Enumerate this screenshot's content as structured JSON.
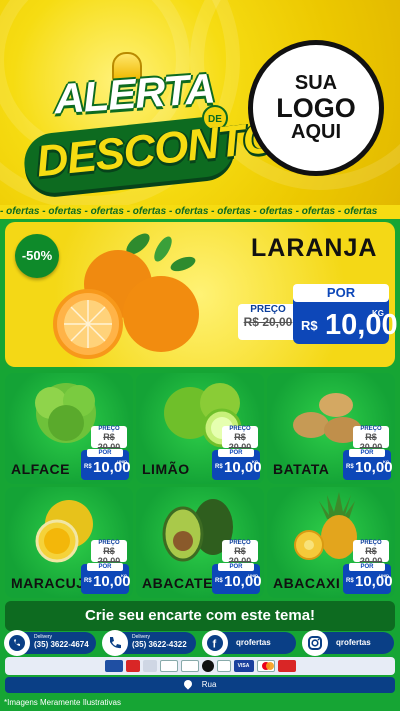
{
  "header": {
    "title_line1": "ALERTA",
    "title_de": "DE",
    "title_line2": "DESCONTO",
    "logo_placeholder": [
      "SUA",
      "LOGO",
      "AQUI"
    ]
  },
  "strip_word": "ofertas",
  "featured": {
    "discount": "-50%",
    "name": "LARANJA",
    "old_label": "PREÇO",
    "old_price": "R$ 20,00",
    "new_label": "POR",
    "currency": "R$",
    "price": "10,00",
    "unit": "KG"
  },
  "products": [
    {
      "name": "ALFACE",
      "old_label": "PREÇO",
      "old_price": "R$ 20,00",
      "new_label": "POR",
      "currency": "R$",
      "price": "10,00",
      "unit": "UNID",
      "icon": "lettuce-icon"
    },
    {
      "name": "LIMÃO",
      "old_label": "PREÇO",
      "old_price": "R$ 20,00",
      "new_label": "POR",
      "currency": "R$",
      "price": "10,00",
      "unit": "KG",
      "icon": "lime-icon"
    },
    {
      "name": "BATATA",
      "old_label": "PREÇO",
      "old_price": "R$ 20,00",
      "new_label": "POR",
      "currency": "R$",
      "price": "10,00",
      "unit": "KG",
      "icon": "potato-icon"
    },
    {
      "name": "MARACUJÁ",
      "old_label": "PREÇO",
      "old_price": "R$ 20,00",
      "new_label": "POR",
      "currency": "R$",
      "price": "10,00",
      "unit": "KG",
      "icon": "passionfruit-icon"
    },
    {
      "name": "ABACATE",
      "old_label": "PREÇO",
      "old_price": "R$ 20,00",
      "new_label": "POR",
      "currency": "R$",
      "price": "10,00",
      "unit": "UNID",
      "icon": "avocado-icon"
    },
    {
      "name": "ABACAXI",
      "old_label": "PREÇO",
      "old_price": "R$ 20,00",
      "new_label": "POR",
      "currency": "R$",
      "price": "10,00",
      "unit": "UNID",
      "icon": "pineapple-icon"
    }
  ],
  "cta": "Crie seu encarte com este tema!",
  "contacts": [
    {
      "icon": "whatsapp-icon",
      "small": "Delivery",
      "text": "(35) 3622-4674"
    },
    {
      "icon": "phone-icon",
      "small": "Delivery",
      "text": "(35) 3622-4322"
    },
    {
      "icon": "facebook-icon",
      "small": "",
      "text": "qrofertas"
    },
    {
      "icon": "instagram-icon",
      "small": "",
      "text": "qrofertas"
    }
  ],
  "payments": [
    "",
    "",
    "",
    "",
    "",
    "",
    "VISA",
    "",
    ""
  ],
  "address": "Rua",
  "footnote": "*Imagens Meramente Ilustrativas",
  "colors": {
    "green": "#16a534",
    "dark_green": "#0d6b20",
    "yellow": "#f6dc12",
    "blue": "#0d47b8",
    "navy": "#0a3f86"
  }
}
